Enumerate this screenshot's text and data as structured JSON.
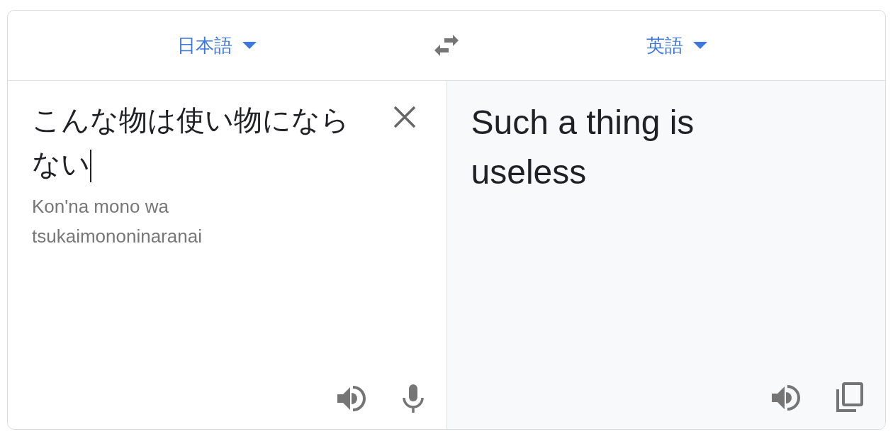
{
  "languages": {
    "source": "日本語",
    "target": "英語"
  },
  "source": {
    "value": "こんな物は使い物にならない",
    "cursor": true,
    "romanization": "Kon'na mono wa tsukaimononinaranai"
  },
  "target": {
    "text": "Such a thing is useless"
  }
}
